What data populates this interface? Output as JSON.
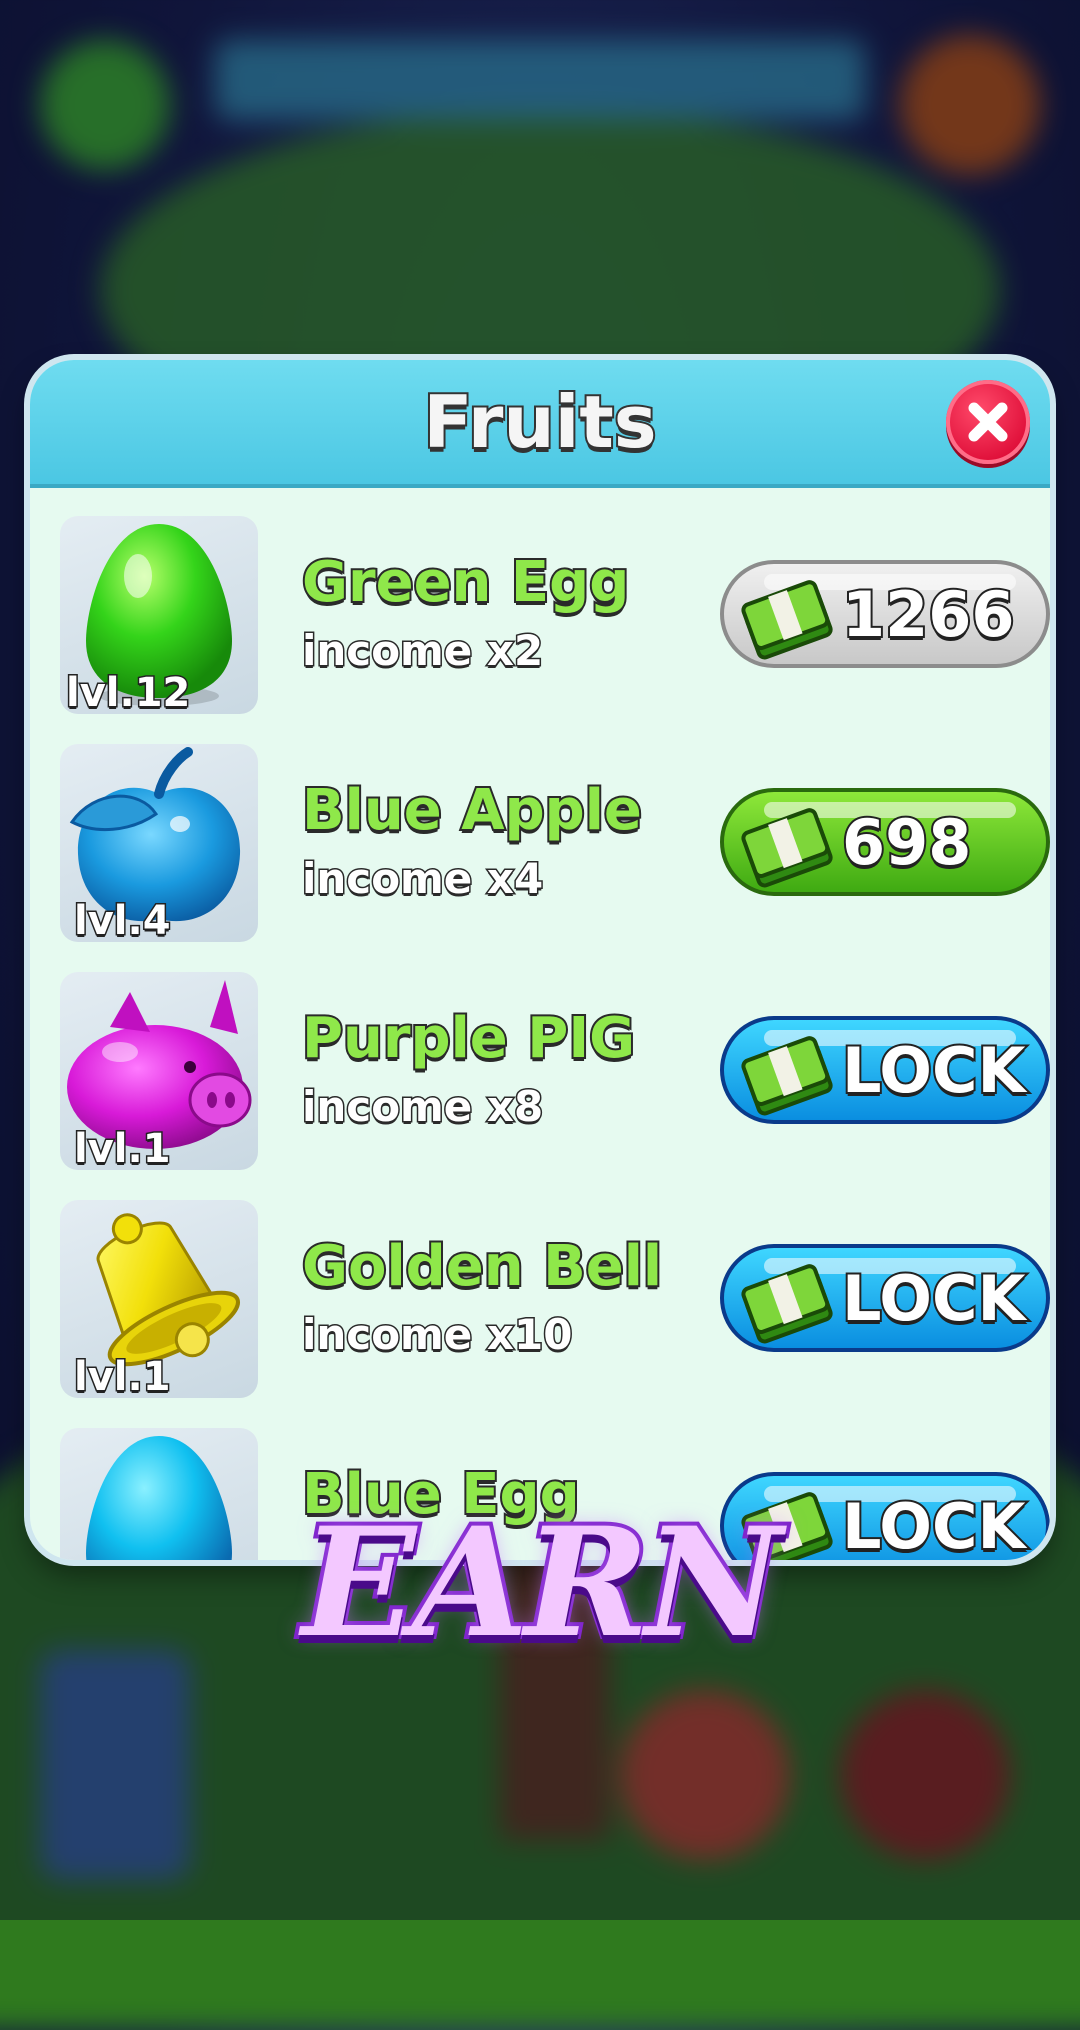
{
  "panel": {
    "title": "Fruits",
    "close_icon": "close-x-icon"
  },
  "items": [
    {
      "name": "Green Egg",
      "income": "income x2",
      "level": "lvl.12",
      "button": "1266",
      "button_state": "disabled",
      "icon": "green-egg-icon"
    },
    {
      "name": "Blue Apple",
      "income": "income x4",
      "level": "lvl.4",
      "button": "698",
      "button_state": "available",
      "icon": "blue-apple-icon"
    },
    {
      "name": "Purple PIG",
      "income": "income x8",
      "level": "lvl.1",
      "button": "LOCK",
      "button_state": "locked",
      "icon": "purple-pig-icon"
    },
    {
      "name": "Golden Bell",
      "income": "income x10",
      "level": "lvl.1",
      "button": "LOCK",
      "button_state": "locked",
      "icon": "golden-bell-icon"
    },
    {
      "name": "Blue Egg",
      "button": "LOCK",
      "button_state": "locked",
      "icon": "blue-egg-icon"
    }
  ],
  "banner": {
    "text": "EARN"
  },
  "colors": {
    "header": "#4bc7e3",
    "panel": "#e6faf0",
    "item_name": "#8fe84a",
    "lock_button": "#0a8ee0",
    "buy_button": "#3faa12",
    "disabled_button": "#c8c8c8",
    "close_button": "#e0103a"
  }
}
